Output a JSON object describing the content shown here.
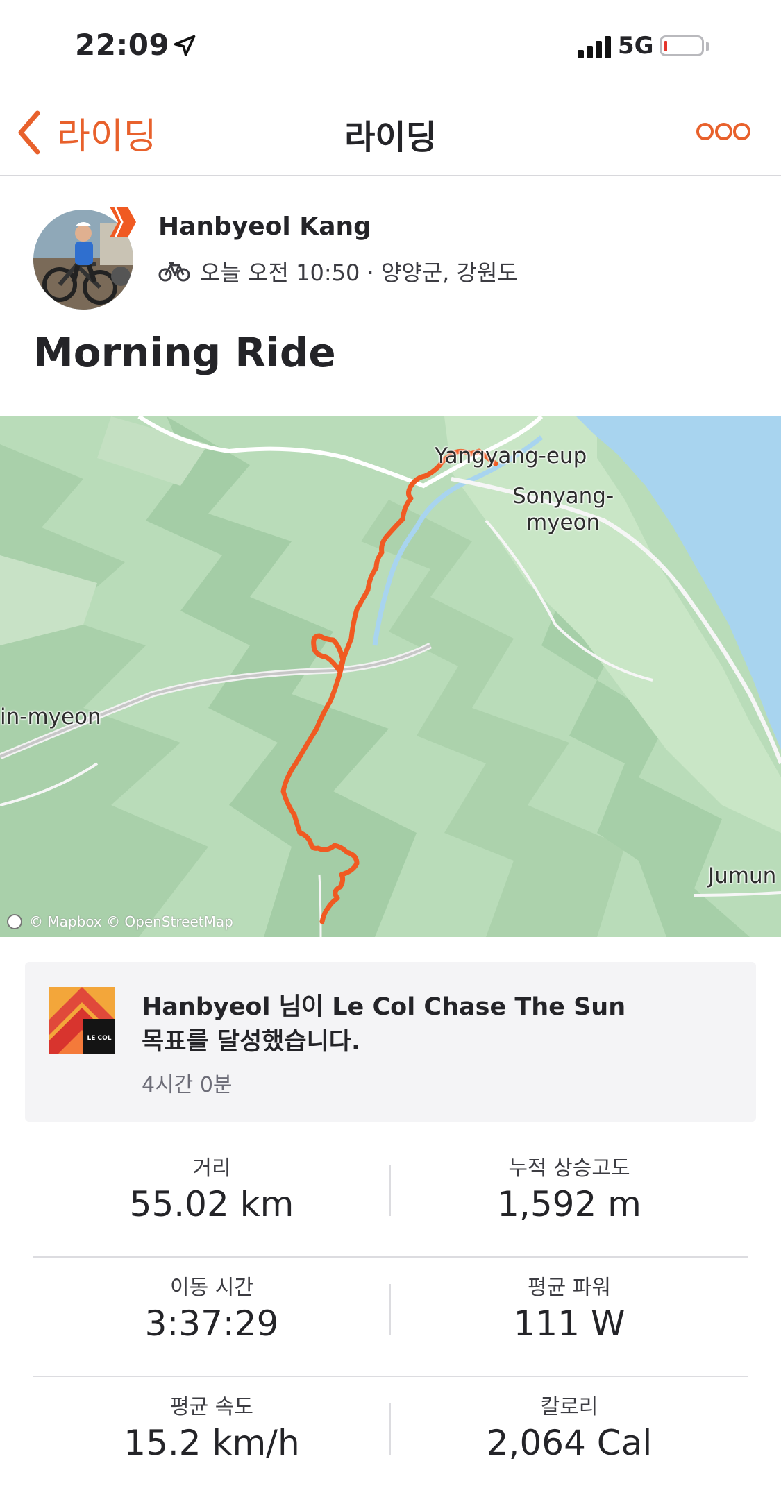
{
  "status_bar": {
    "time": "22:09",
    "network": "5G"
  },
  "nav": {
    "back_label": "라이딩",
    "title": "라이딩"
  },
  "athlete": {
    "name": "Hanbyeol Kang",
    "meta": "오늘 오전 10:50 · 양양군, 강원도"
  },
  "activity": {
    "title": "Morning Ride"
  },
  "map": {
    "labels": [
      "Yangyang-eup",
      "Sonyang-\nmyeon",
      "in-myeon",
      "Jumun"
    ],
    "attribution": "© Mapbox © OpenStreetMap",
    "route_color": "#f05a22",
    "water_color": "#a8d4ef"
  },
  "achievement": {
    "line1": "Hanbyeol 님이 Le Col Chase The Sun",
    "line2": "목표를 달성했습니다.",
    "duration": "4시간 0분",
    "badge_text": "LE COL"
  },
  "stats": [
    {
      "left": {
        "label": "거리",
        "value": "55.02 km"
      },
      "right": {
        "label": "누적 상승고도",
        "value": "1,592 m"
      }
    },
    {
      "left": {
        "label": "이동 시간",
        "value": "3:37:29"
      },
      "right": {
        "label": "평균 파워",
        "value": "111 W"
      }
    },
    {
      "left": {
        "label": "평균 속도",
        "value": "15.2 km/h"
      },
      "right": {
        "label": "칼로리",
        "value": "2,064 Cal"
      }
    }
  ],
  "colors": {
    "accent": "#e8612c"
  }
}
